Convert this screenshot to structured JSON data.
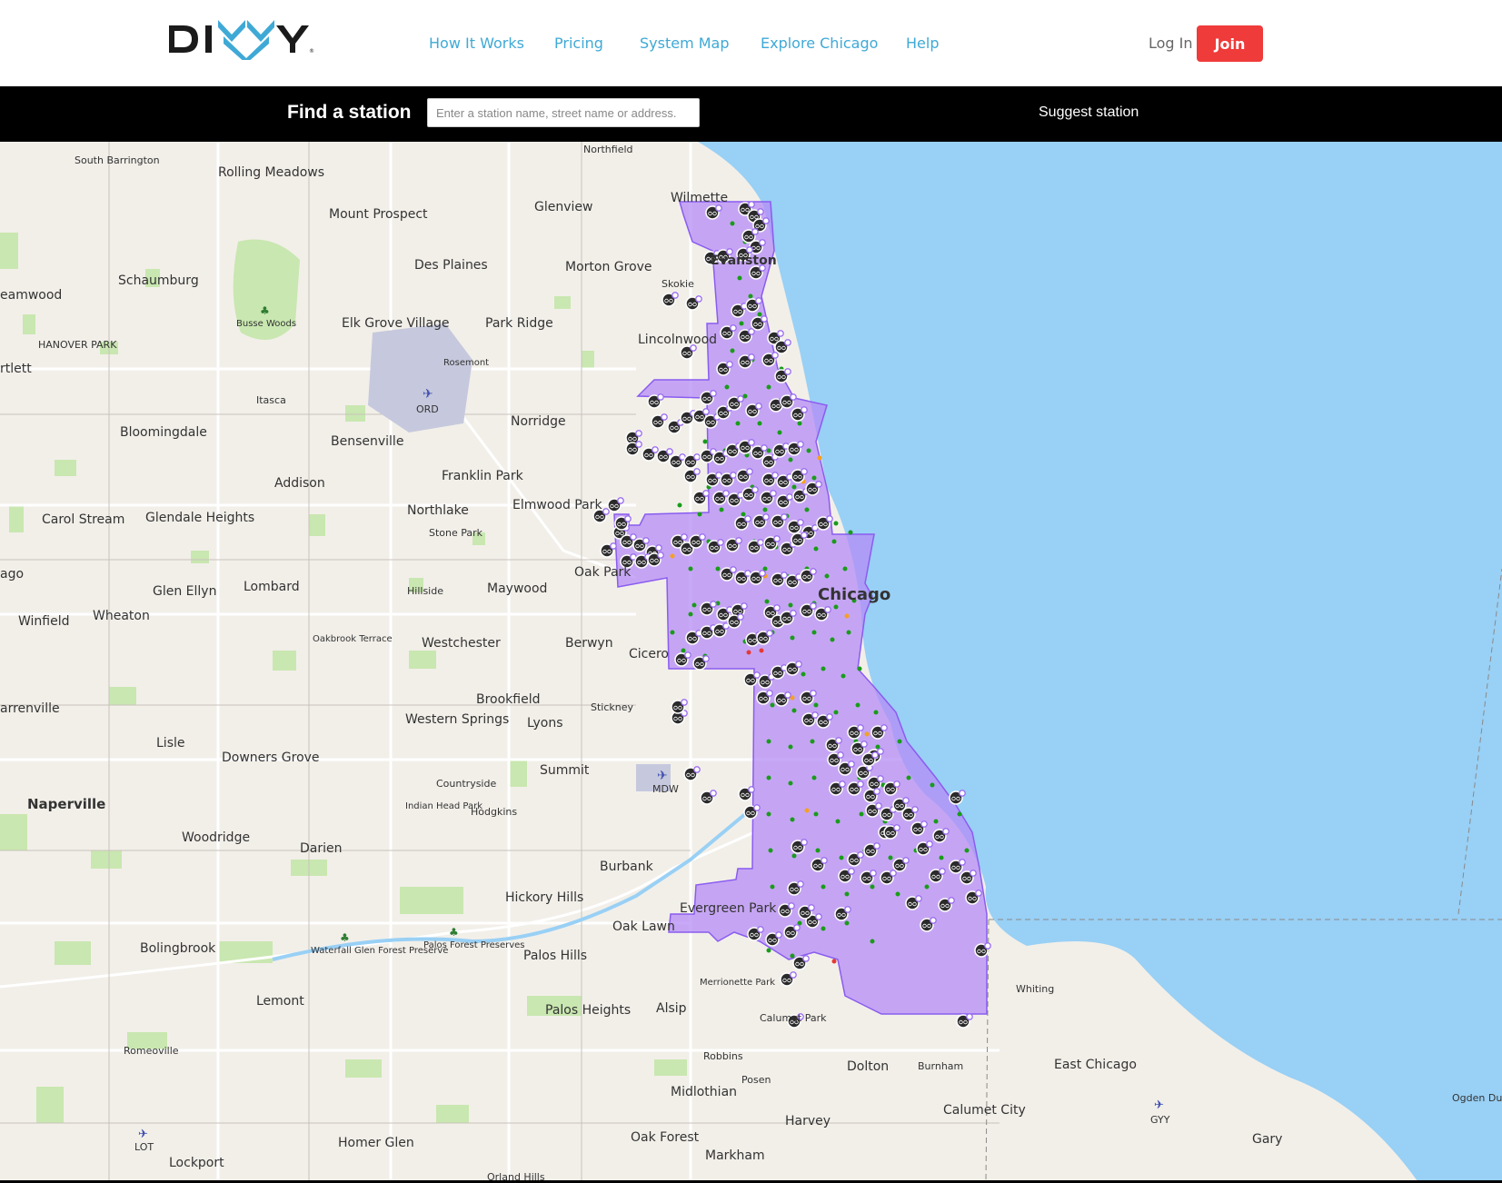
{
  "brand": {
    "name": "DIVVY"
  },
  "nav": {
    "how_it_works": "How It Works",
    "pricing": "Pricing",
    "system_map": "System Map",
    "explore_chicago": "Explore Chicago",
    "help": "Help",
    "login": "Log In",
    "join": "Join"
  },
  "find": {
    "label": "Find a station",
    "placeholder": "Enter a station name, street name or address.",
    "value": "",
    "suggest": "Suggest station"
  },
  "map": {
    "colors": {
      "water": "#99d0f5",
      "land": "#f2efe9",
      "park": "#c9e7b0",
      "service_area": "#b58cf5",
      "service_border": "#8a5cf0",
      "station_green": "#1a9b1a",
      "station_orange": "#f5a020",
      "station_red": "#e53935",
      "bike_pin": "#2a2a2a",
      "ebike_badge": "#9b6df0"
    },
    "labels": {
      "northfield": "Northfield",
      "south_barrington": "South Barrington",
      "rolling_meadows": "Rolling Meadows",
      "mount_prospect": "Mount Prospect",
      "glenview": "Glenview",
      "wilmette": "Wilmette",
      "schaumburg": "Schaumburg",
      "des_plaines": "Des Plaines",
      "morton_grove": "Morton Grove",
      "evanston": "Evanston",
      "streamwood": "eamwood",
      "skokie": "Skokie",
      "busse_woods": "Busse Woods",
      "elk_grove": "Elk Grove Village",
      "park_ridge": "Park Ridge",
      "lincolnwood": "Lincolnwood",
      "hanover_park": "HANOVER PARK",
      "bartlett": "rtlett",
      "rosemont": "Rosemont",
      "itasca": "Itasca",
      "ord": "ORD",
      "norridge": "Norridge",
      "bloomingdale": "Bloomingdale",
      "bensenville": "Bensenville",
      "franklin_park": "Franklin Park",
      "addison": "Addison",
      "elmwood_park": "Elmwood Park",
      "northlake": "Northlake",
      "carol_stream": "Carol Stream",
      "glendale_heights": "Glendale Heights",
      "stone_park": "Stone Park",
      "oak_park": "Oak Park",
      "chicago_label": "Chicago",
      "chicago_west": "ago",
      "glen_ellyn": "Glen Ellyn",
      "lombard": "Lombard",
      "hillside": "Hillside",
      "maywood": "Maywood",
      "winfield": "Winfield",
      "wheaton": "Wheaton",
      "oakbrook_terrace": "Oakbrook Terrace",
      "westchester": "Westchester",
      "berwyn": "Berwyn",
      "cicero": "Cicero",
      "brookfield": "Brookfield",
      "warrenville": "arrenville",
      "western_springs": "Western Springs",
      "stickney": "Stickney",
      "lyons": "Lyons",
      "lisle": "Lisle",
      "downers_grove": "Downers Grove",
      "summit": "Summit",
      "mdw": "MDW",
      "countryside": "Countryside",
      "naperville": "Naperville",
      "indian_head_park": "Indian Head Park",
      "hodgkins": "Hodgkins",
      "woodridge": "Woodridge",
      "darien": "Darien",
      "burbank": "Burbank",
      "hickory_hills": "Hickory Hills",
      "evergreen_park": "Evergreen Park",
      "oak_lawn": "Oak Lawn",
      "bolingbrook": "Bolingbrook",
      "waterfall_glen": "Waterfall Glen Forest Preserve",
      "palos_forest": "Palos Forest Preserves",
      "palos_hills": "Palos Hills",
      "whiting": "Whiting",
      "merrionette_park": "Merrionette Park",
      "lemont": "Lemont",
      "palos_heights": "Palos Heights",
      "alsip": "Alsip",
      "calumet_park": "Calumet Park",
      "romeoville": "Romeoville",
      "robbins": "Robbins",
      "dolton": "Dolton",
      "burnham": "Burnham",
      "east_chicago": "East Chicago",
      "posen": "Posen",
      "midlothian": "Midlothian",
      "calumet_city": "Calumet City",
      "harvey": "Harvey",
      "gyy": "GYY",
      "ogden_dunes": "Ogden Dun",
      "lot": "LOT",
      "homer_glen": "Homer Glen",
      "oak_forest": "Oak Forest",
      "gary": "Gary",
      "lockport": "Lockport",
      "markham": "Markham",
      "orland_hills": "Orland Hills"
    }
  }
}
